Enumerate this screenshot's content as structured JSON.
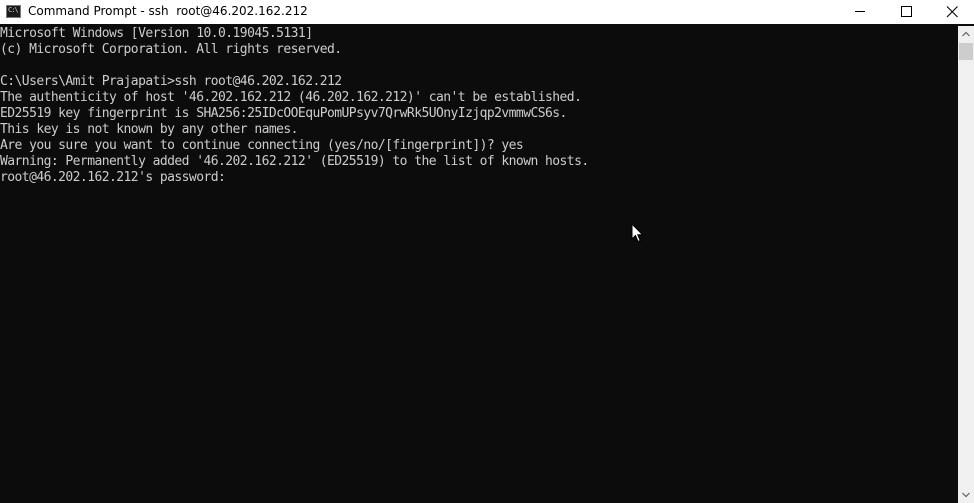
{
  "window": {
    "title": "Command Prompt - ssh  root@46.202.162.212",
    "app_icon_glyph": "C:\\",
    "buttons": [
      "minimize",
      "maximize",
      "close"
    ]
  },
  "console": {
    "lines": [
      "Microsoft Windows [Version 10.0.19045.5131]",
      "(c) Microsoft Corporation. All rights reserved.",
      "",
      "C:\\Users\\Amit Prajapati>ssh root@46.202.162.212",
      "The authenticity of host '46.202.162.212 (46.202.162.212)' can't be established.",
      "ED25519 key fingerprint is SHA256:25IDcOOEquPomUPsyv7QrwRk5UOnyIzjqp2vmmwCS6s.",
      "This key is not known by any other names.",
      "Are you sure you want to continue connecting (yes/no/[fingerprint])? yes",
      "Warning: Permanently added '46.202.162.212' (ED25519) to the list of known hosts.",
      "root@46.202.162.212's password:"
    ]
  },
  "colors": {
    "console_background": "#0c0c0c",
    "console_text": "#cccccc",
    "titlebar_background": "#ffffff"
  }
}
